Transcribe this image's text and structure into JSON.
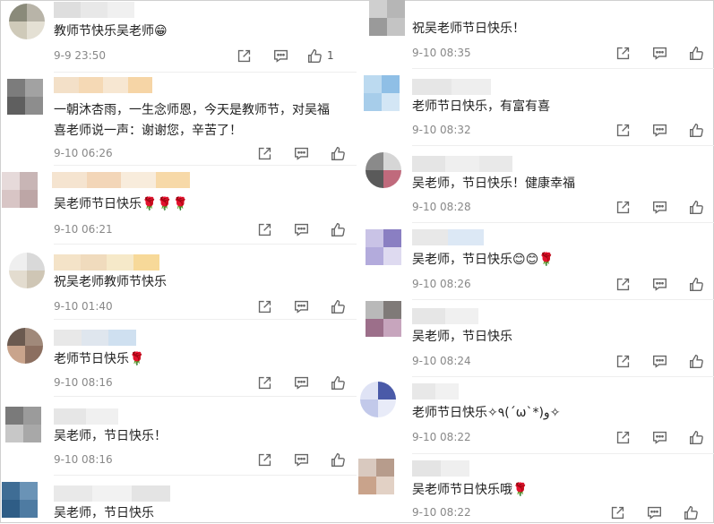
{
  "left": [
    {
      "text": "教师节快乐吴老师😁",
      "time": "9-9 23:50",
      "likes": "1"
    },
    {
      "text": "一朝沐杏雨，一生念师恩，今天是教师节，对吴福",
      "text2": "喜老师说一声：谢谢您，辛苦了！",
      "time": "9-10 06:26"
    },
    {
      "text": "吴老师节日快乐🌹🌹🌹",
      "time": "9-10 06:21"
    },
    {
      "text": "祝吴老师教师节快乐",
      "time": "9-10 01:40"
    },
    {
      "text": "老师节日快乐🌹",
      "time": "9-10 08:16"
    },
    {
      "text": "吴老师，节日快乐！",
      "time": "9-10 08:16"
    },
    {
      "text": "吴老师，节日快乐",
      "time": ""
    }
  ],
  "right": [
    {
      "text": "祝吴老师节日快乐！",
      "time": "9-10 08:35"
    },
    {
      "text": "老师节日快乐，有富有喜",
      "time": "9-10 08:32"
    },
    {
      "text": "吴老师，节日快乐！健康幸福",
      "time": "9-10 08:28"
    },
    {
      "text": "吴老师，节日快乐😊😊🌹",
      "time": "9-10 08:26"
    },
    {
      "text": "吴老师，节日快乐",
      "time": "9-10 08:24"
    },
    {
      "text": "老师节日快乐✧٩(ˊωˋ*)و✧",
      "time": "9-10 08:22"
    },
    {
      "text": "吴老师节日快乐哦🌹",
      "time": "9-10 08:22"
    }
  ],
  "icons": {
    "share": "share-icon",
    "comment": "comment-icon",
    "like": "thumbs-up-icon"
  },
  "colors": {
    "text": "#222222",
    "meta": "#888888",
    "icon": "#666666"
  }
}
